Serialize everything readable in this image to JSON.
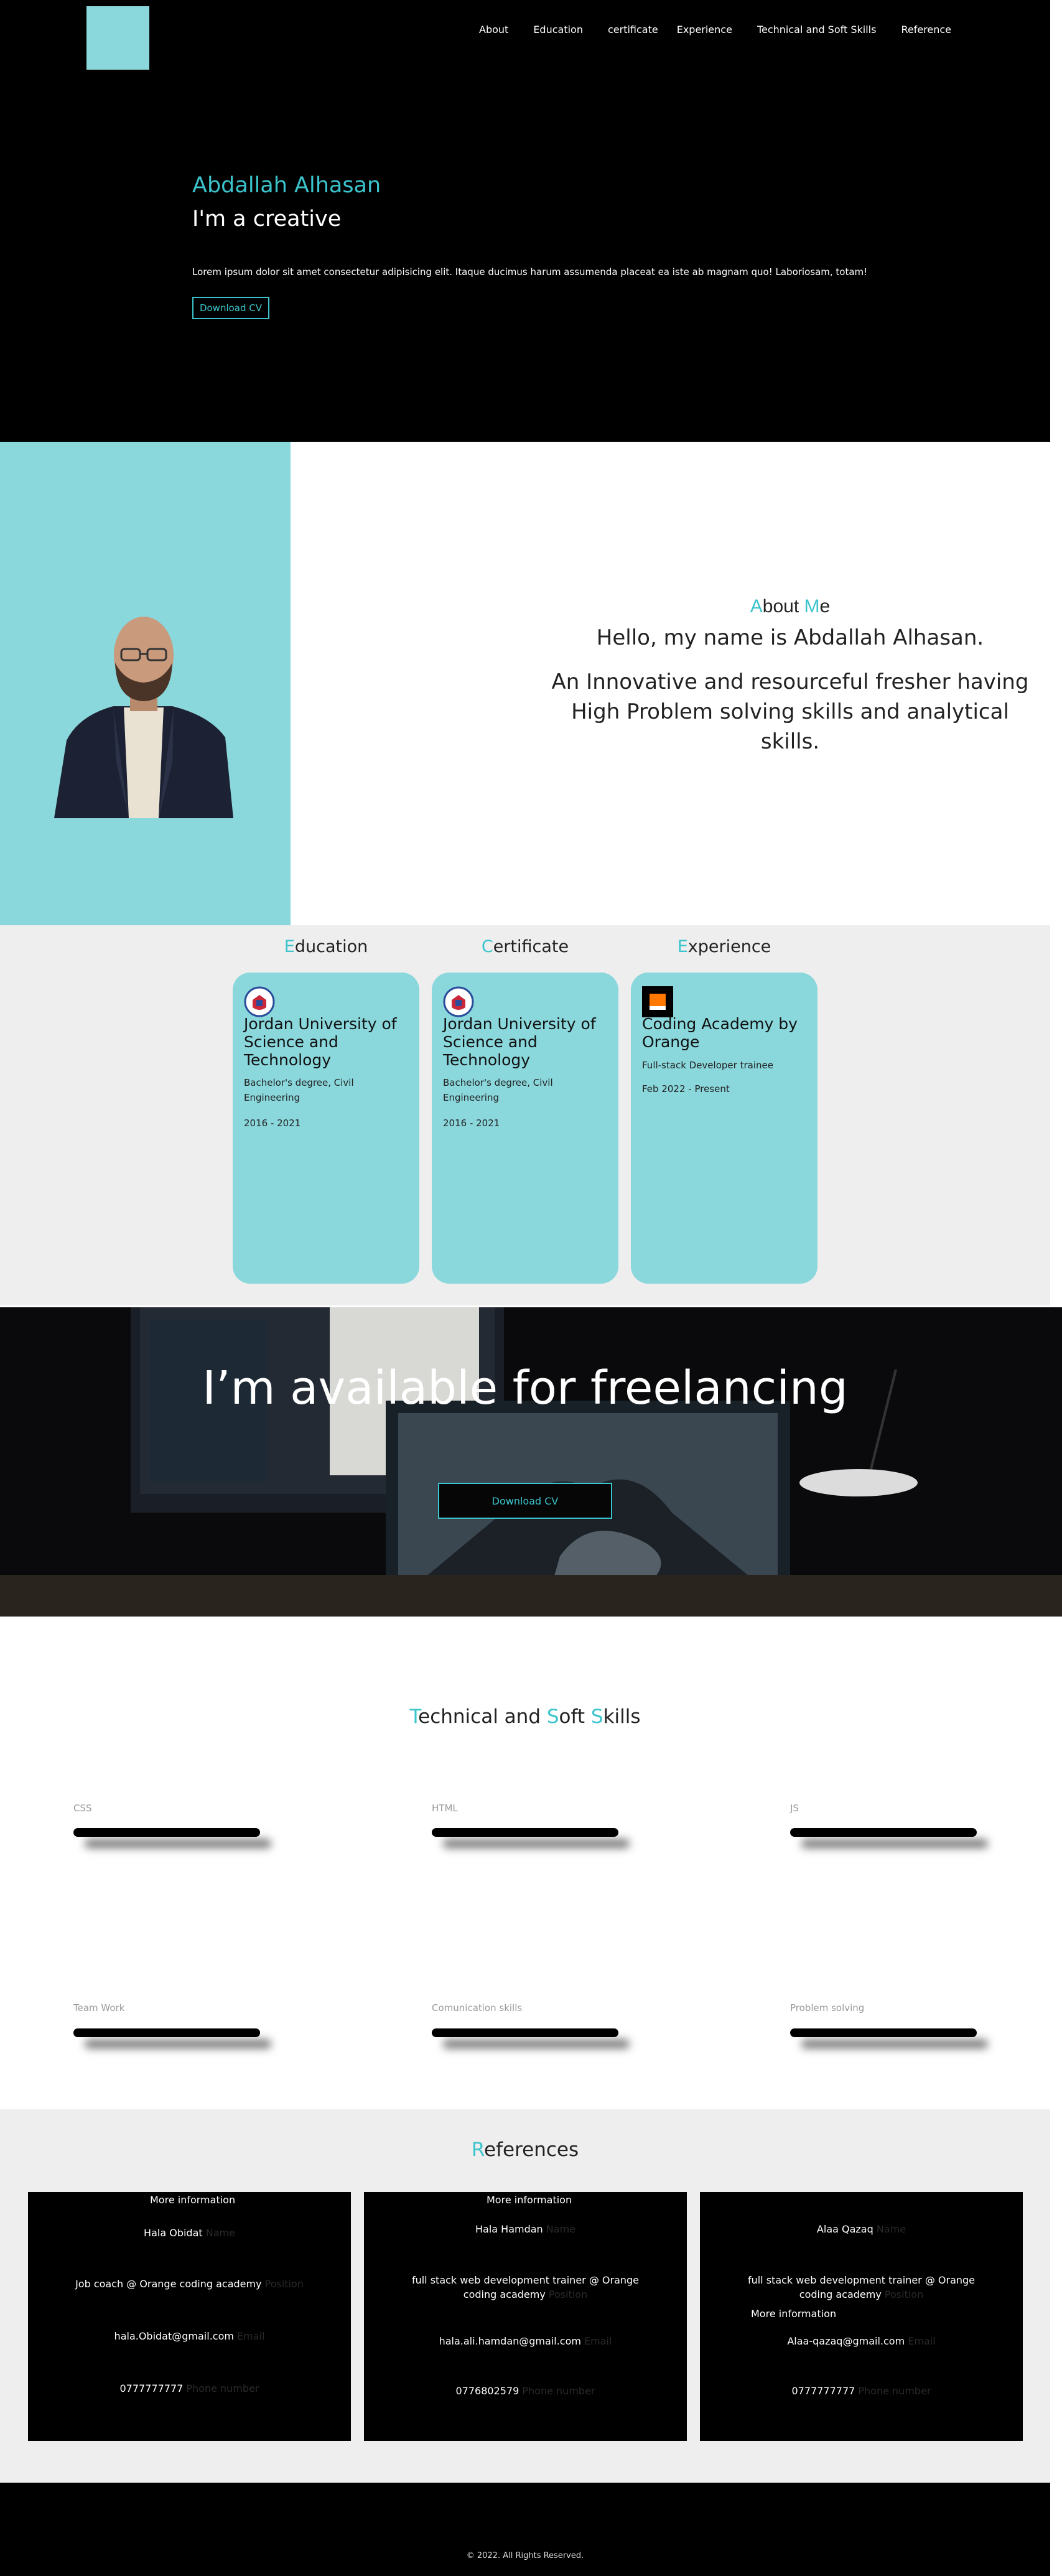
{
  "nav": {
    "items": [
      "About",
      "Education",
      "certificate",
      "Experience",
      "Technical and Soft Skills",
      "Reference"
    ]
  },
  "hero": {
    "name": "Abdallah Alhasan",
    "tagline": "I'm a creative",
    "description": "Lorem ipsum dolor sit amet consectetur adipisicing elit. Itaque ducimus harum assumenda placeat ea iste ab magnam quo! Laboriosam, totam!",
    "cv_button": "Download CV"
  },
  "about": {
    "title_first": "A",
    "title_rest1": "bout ",
    "title_second": "M",
    "title_rest2": "e",
    "hello": "Hello, my name is Abdallah Alhasan.",
    "text": "An Innovative and resourceful fresher having High Problem solving skills and analytical skills."
  },
  "columns": {
    "education": {
      "first": "E",
      "rest": "ducation"
    },
    "certificate": {
      "first": "C",
      "rest": "ertificate"
    },
    "experience": {
      "first": "E",
      "rest": "xperience"
    }
  },
  "cards": [
    {
      "title": "Jordan University of Science and Technology",
      "sub": "Bachelor's degree, Civil Engineering",
      "date": "2016 - 2021"
    },
    {
      "title": "Jordan University of Science and Technology",
      "sub": "Bachelor's degree, Civil Engineering",
      "date": "2016 - 2021"
    },
    {
      "title": "Coding Academy by Orange",
      "sub": "Full-stack Developer trainee",
      "date": "Feb 2022 - Present"
    }
  ],
  "freelance": {
    "title": "I’m available for freelancing",
    "cv_button": "Download CV"
  },
  "skills": {
    "t1": "T",
    "r1": "echnical and ",
    "t2": "S",
    "r2": "oft ",
    "t3": "S",
    "r3": "kills",
    "items": [
      {
        "label": "CSS",
        "level": 1.0
      },
      {
        "label": "HTML",
        "level": 1.0
      },
      {
        "label": "JS",
        "level": 1.0
      },
      {
        "label": "Team Work",
        "level": 1.0
      },
      {
        "label": "Comunication skills",
        "level": 1.0
      },
      {
        "label": "Problem solving",
        "level": 1.0
      }
    ]
  },
  "references": {
    "first": "R",
    "rest": "eferences",
    "more_label": "More information",
    "ph_name": "Name",
    "ph_position": "Position",
    "ph_email": "Email",
    "ph_phone": "Phone number",
    "people": [
      {
        "name": "Hala Obidat",
        "position": "Job coach @ Orange coding academy",
        "email": "hala.Obidat@gmail.com",
        "phone": "0777777777"
      },
      {
        "name": "Hala Hamdan",
        "position": "full stack web development trainer @ Orange coding academy",
        "email": "hala.ali.hamdan@gmail.com",
        "phone": "0776802579"
      },
      {
        "name": "Alaa Qazaq",
        "position": "full stack web development trainer @ Orange coding academy",
        "email": "Alaa-qazaq@gmail.com",
        "phone": "0777777777"
      }
    ]
  },
  "footer": {
    "text": "© 2022. All Rights Reserved."
  },
  "colors": {
    "accent": "#3cc4cc",
    "panel": "#8ad7dc",
    "dark": "#000000",
    "light_section": "#eeeeee"
  }
}
